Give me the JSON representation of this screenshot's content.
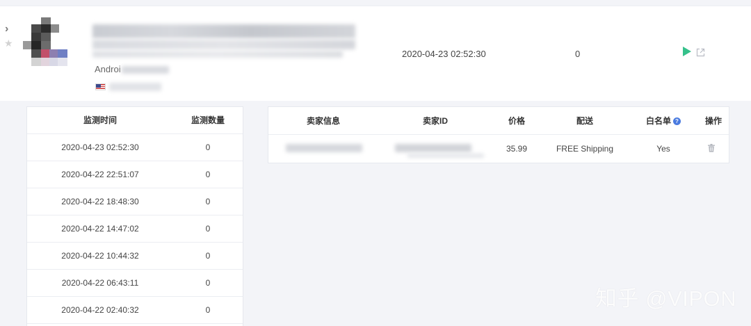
{
  "product": {
    "detect_time": "2020-04-23 02:52:30",
    "detect_count": "0",
    "platform_text": "Androi"
  },
  "history": {
    "headers": {
      "time": "监测时间",
      "count": "监测数量"
    },
    "rows": [
      {
        "time": "2020-04-23 02:52:30",
        "count": "0"
      },
      {
        "time": "2020-04-22 22:51:07",
        "count": "0"
      },
      {
        "time": "2020-04-22 18:48:30",
        "count": "0"
      },
      {
        "time": "2020-04-22 14:47:02",
        "count": "0"
      },
      {
        "time": "2020-04-22 10:44:32",
        "count": "0"
      },
      {
        "time": "2020-04-22 06:43:11",
        "count": "0"
      },
      {
        "time": "2020-04-22 02:40:32",
        "count": "0"
      }
    ]
  },
  "sellers": {
    "headers": {
      "info": "卖家信息",
      "id": "卖家ID",
      "price": "价格",
      "shipping": "配送",
      "whitelist": "白名单",
      "action": "操作"
    },
    "rows": [
      {
        "price": "35.99",
        "shipping": "FREE Shipping",
        "whitelist": "Yes"
      }
    ]
  },
  "icons": {
    "expand": "chevron-right-icon",
    "favorite": "star-icon",
    "play": "play-icon",
    "external": "external-link-icon",
    "help": "question-circle-icon",
    "delete": "trash-icon"
  },
  "colors": {
    "play": "#35c18b",
    "help": "#4a7be0",
    "background": "#f3f4f8"
  },
  "watermark": "知乎 @VIPON"
}
